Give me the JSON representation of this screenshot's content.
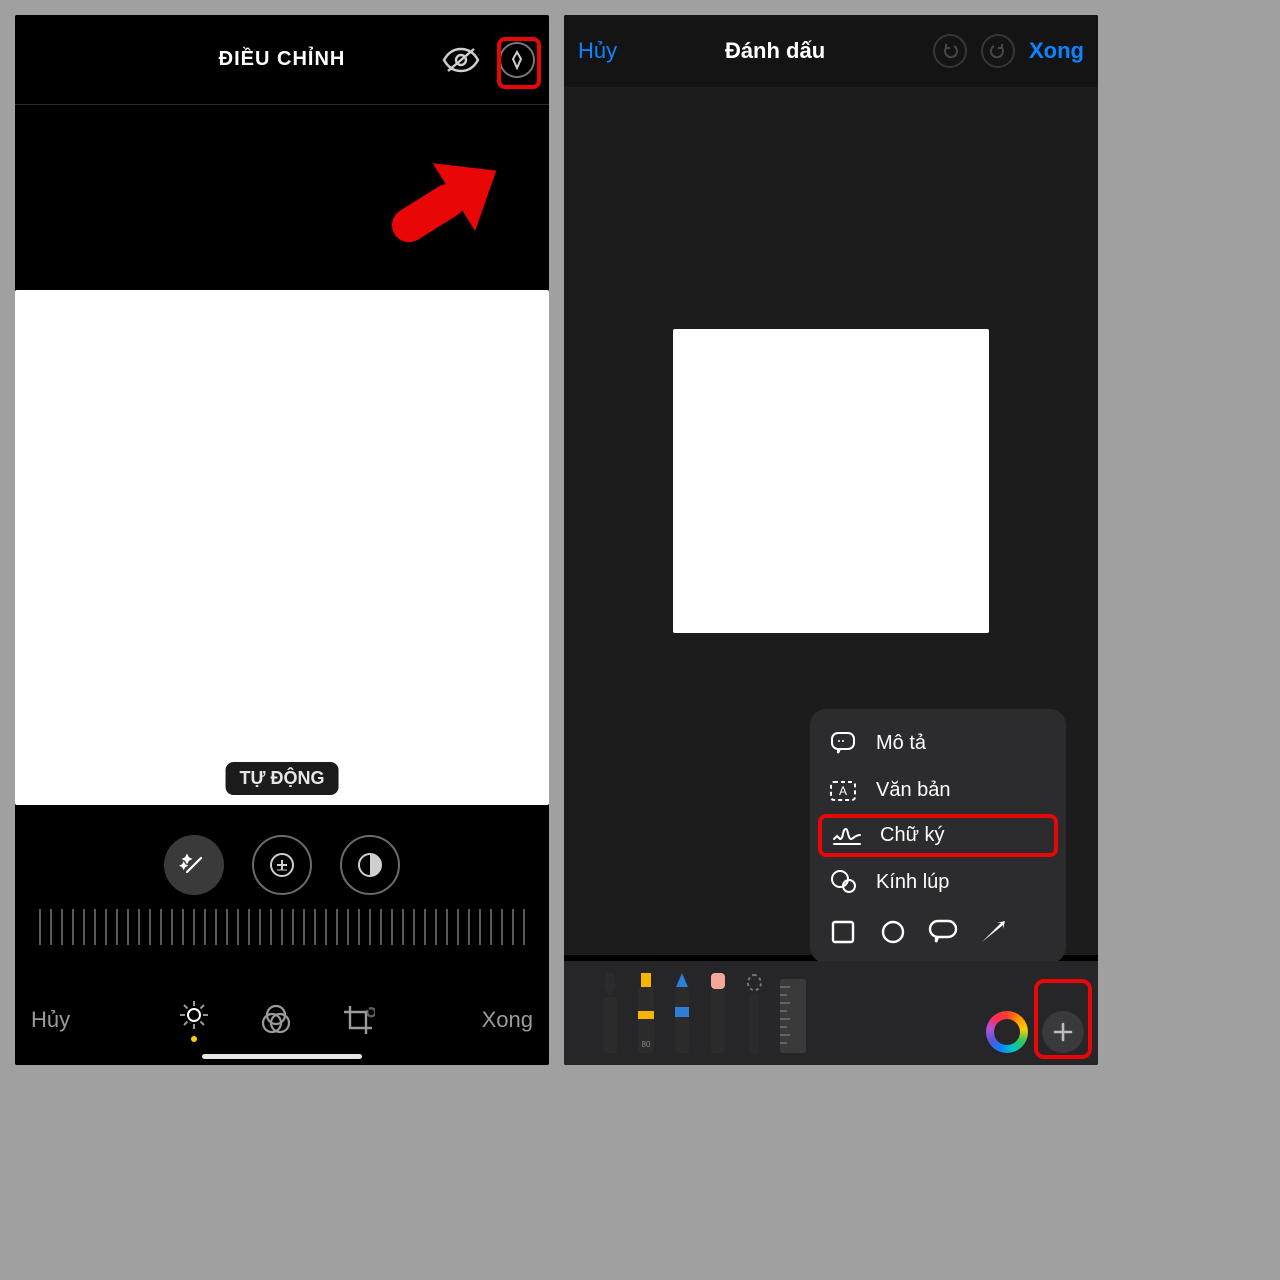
{
  "left": {
    "header_title": "ĐIỀU CHỈNH",
    "auto_label": "TỰ ĐỘNG",
    "cancel": "Hủy",
    "done": "Xong"
  },
  "right": {
    "header": {
      "cancel": "Hủy",
      "title": "Đánh dấu",
      "done": "Xong"
    },
    "popup": {
      "description": "Mô tả",
      "text": "Văn bản",
      "signature": "Chữ ký",
      "magnifier": "Kính lúp"
    }
  }
}
